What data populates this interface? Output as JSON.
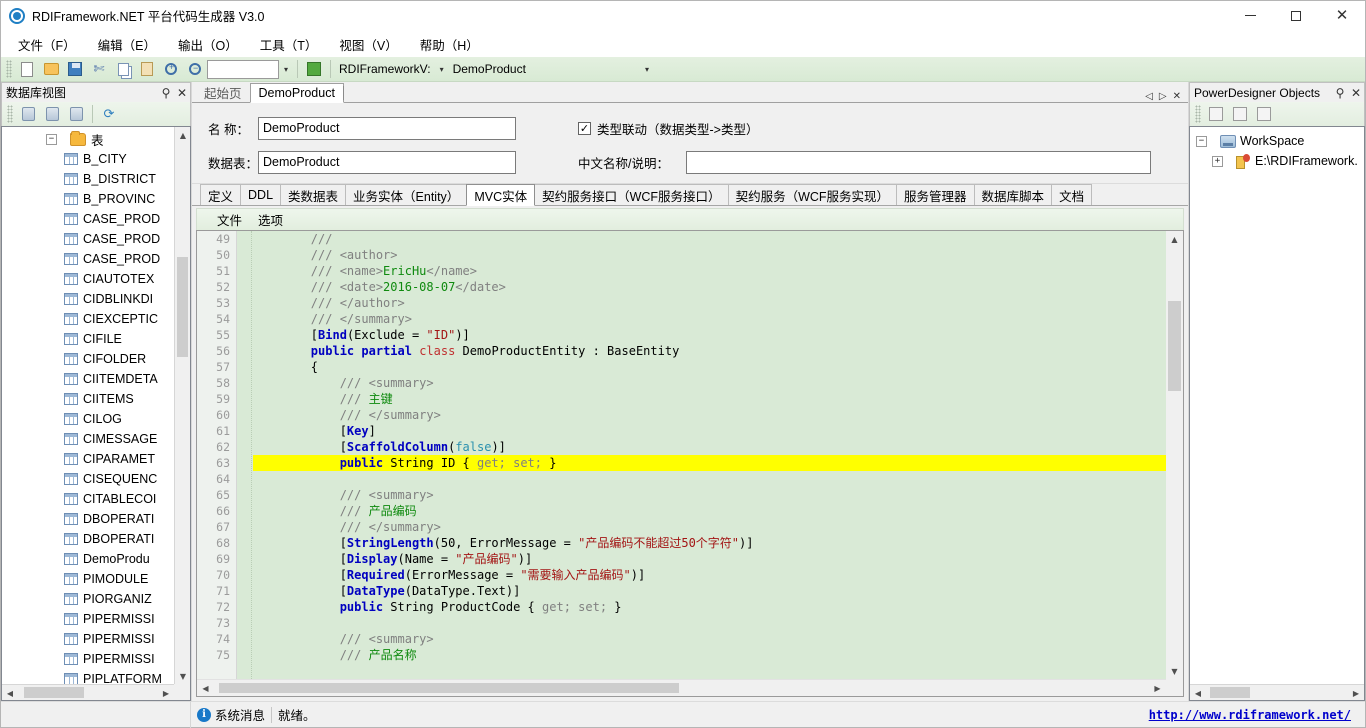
{
  "window": {
    "title": "RDIFramework.NET 平台代码生成器 V3.0",
    "minimize": "—",
    "maximize": "❐",
    "close": "✕"
  },
  "menubar": {
    "items": [
      {
        "label": "文件（F）",
        "name": "menu-file"
      },
      {
        "label": "编辑（E）",
        "name": "menu-edit"
      },
      {
        "label": "输出（O）",
        "name": "menu-output"
      },
      {
        "label": "工具（T）",
        "name": "menu-tools"
      },
      {
        "label": "视图（V）",
        "name": "menu-view"
      },
      {
        "label": "帮助（H）",
        "name": "menu-help"
      }
    ]
  },
  "toolbar": {
    "buttons": [
      {
        "icon": "new-file-icon"
      },
      {
        "icon": "open-folder-icon"
      },
      {
        "icon": "save-icon"
      },
      {
        "icon": "cut-icon"
      },
      {
        "icon": "copy-icon"
      },
      {
        "icon": "paste-icon"
      },
      {
        "icon": "zoom-in-icon"
      },
      {
        "icon": "zoom-out-icon"
      }
    ],
    "search_value": "",
    "search_placeholder": "",
    "dropdown_arrow": "▾",
    "go_icon": "run-icon",
    "connection": "RDIFrameworkV:",
    "table": "DemoProduct"
  },
  "left_dock": {
    "title": "数据库视图",
    "pin_glyph": "⚲",
    "close_glyph": "✕",
    "toolbar_buttons": [
      {
        "icon": "db-add-icon"
      },
      {
        "icon": "db-edit-icon"
      },
      {
        "icon": "db-delete-icon"
      },
      {
        "icon": "refresh-icon"
      }
    ],
    "root": {
      "label": "表",
      "expander": "−"
    },
    "tables": [
      "B_CITY",
      "B_DISTRICT",
      "B_PROVINC",
      "CASE_PROD",
      "CASE_PROD",
      "CASE_PROD",
      "CIAUTOTEX",
      "CIDBLINKDI",
      "CIEXCEPTIC",
      "CIFILE",
      "CIFOLDER",
      "CIITEMDETA",
      "CIITEMS",
      "CILOG",
      "CIMESSAGE",
      "CIPARAMET",
      "CISEQUENC",
      "CITABLECOI",
      "DBOPERATI",
      "DBOPERATI",
      "DemoProdu",
      "PIMODULE",
      "PIORGANIZ",
      "PIPERMISSI",
      "PIPERMISSI",
      "PIPERMISSI",
      "PIPLATFORM"
    ]
  },
  "document_tabs": {
    "tabs": [
      {
        "label": "起始页",
        "active": false
      },
      {
        "label": "DemoProduct",
        "active": true
      }
    ],
    "nav_prev": "◁",
    "nav_next": "▷",
    "nav_close": "✕"
  },
  "form": {
    "name_label": "名 称：",
    "name_value": "DemoProduct",
    "table_label": "数据表：",
    "table_value": "DemoProduct",
    "checkbox_label": "类型联动（数据类型->类型）",
    "checkbox_checked": true,
    "checkbox_glyph": "✓",
    "cn_label": "中文名称/说明：",
    "cn_value": "",
    "cn_placeholder": ""
  },
  "tabstrip": {
    "tabs": [
      {
        "label": "定义",
        "active": false
      },
      {
        "label": "DDL",
        "active": false
      },
      {
        "label": "类数据表",
        "active": false
      },
      {
        "label": "业务实体（Entity）",
        "active": false
      },
      {
        "label": "MVC实体",
        "active": true
      },
      {
        "label": "契约服务接口（WCF服务接口）",
        "active": false
      },
      {
        "label": "契约服务（WCF服务实现）",
        "active": false
      },
      {
        "label": "服务管理器",
        "active": false
      },
      {
        "label": "数据库脚本",
        "active": false
      },
      {
        "label": "文档",
        "active": false
      }
    ]
  },
  "editor": {
    "menu": [
      {
        "label": "文件"
      },
      {
        "label": "选项"
      }
    ],
    "first_line_number": 49,
    "lines": [
      {
        "n": 49,
        "highlight": false,
        "tokens": [
          {
            "t": "        /// ",
            "c": "c-com"
          }
        ]
      },
      {
        "n": 50,
        "highlight": false,
        "tokens": [
          {
            "t": "        /// <author>",
            "c": "c-com"
          }
        ]
      },
      {
        "n": 51,
        "highlight": false,
        "tokens": [
          {
            "t": "        /// <name>",
            "c": "c-com"
          },
          {
            "t": "EricHu",
            "c": "c-comzh"
          },
          {
            "t": "</name>",
            "c": "c-com"
          }
        ]
      },
      {
        "n": 52,
        "highlight": false,
        "tokens": [
          {
            "t": "        /// <date>",
            "c": "c-com"
          },
          {
            "t": "2016-08-07",
            "c": "c-comzh"
          },
          {
            "t": "</date>",
            "c": "c-com"
          }
        ]
      },
      {
        "n": 53,
        "highlight": false,
        "tokens": [
          {
            "t": "        /// </author>",
            "c": "c-com"
          }
        ]
      },
      {
        "n": 54,
        "highlight": false,
        "tokens": [
          {
            "t": "        /// </summary>",
            "c": "c-com"
          }
        ]
      },
      {
        "n": 55,
        "highlight": false,
        "tokens": [
          {
            "t": "        [",
            "c": "c-plain"
          },
          {
            "t": "Bind",
            "c": "c-attr"
          },
          {
            "t": "(Exclude = ",
            "c": "c-plain"
          },
          {
            "t": "\"ID\"",
            "c": "c-str"
          },
          {
            "t": ")]",
            "c": "c-plain"
          }
        ]
      },
      {
        "n": 56,
        "highlight": false,
        "tokens": [
          {
            "t": "        ",
            "c": "c-plain"
          },
          {
            "t": "public",
            "c": "c-kw"
          },
          {
            "t": " ",
            "c": "c-plain"
          },
          {
            "t": "partial",
            "c": "c-kw"
          },
          {
            "t": " ",
            "c": "c-plain"
          },
          {
            "t": "class",
            "c": "c-red"
          },
          {
            "t": " DemoProductEntity : BaseEntity",
            "c": "c-plain"
          }
        ]
      },
      {
        "n": 57,
        "highlight": false,
        "tokens": [
          {
            "t": "        {",
            "c": "c-plain"
          }
        ]
      },
      {
        "n": 58,
        "highlight": false,
        "tokens": [
          {
            "t": "            /// <summary>",
            "c": "c-com"
          }
        ]
      },
      {
        "n": 59,
        "highlight": false,
        "tokens": [
          {
            "t": "            /// ",
            "c": "c-com"
          },
          {
            "t": "主键",
            "c": "c-comzh"
          }
        ]
      },
      {
        "n": 60,
        "highlight": false,
        "tokens": [
          {
            "t": "            /// </summary>",
            "c": "c-com"
          }
        ]
      },
      {
        "n": 61,
        "highlight": false,
        "tokens": [
          {
            "t": "            [",
            "c": "c-plain"
          },
          {
            "t": "Key",
            "c": "c-attr"
          },
          {
            "t": "]",
            "c": "c-plain"
          }
        ]
      },
      {
        "n": 62,
        "highlight": false,
        "tokens": [
          {
            "t": "            [",
            "c": "c-plain"
          },
          {
            "t": "ScaffoldColumn",
            "c": "c-attr"
          },
          {
            "t": "(",
            "c": "c-plain"
          },
          {
            "t": "false",
            "c": "c-type"
          },
          {
            "t": ")]",
            "c": "c-plain"
          }
        ]
      },
      {
        "n": 63,
        "highlight": true,
        "tokens": [
          {
            "t": "            ",
            "c": "c-plain"
          },
          {
            "t": "public",
            "c": "c-kw"
          },
          {
            "t": " String ID { ",
            "c": "c-plain"
          },
          {
            "t": "get; set;",
            "c": "c-getset"
          },
          {
            "t": " }",
            "c": "c-plain"
          }
        ]
      },
      {
        "n": 64,
        "highlight": false,
        "tokens": [
          {
            "t": "",
            "c": "c-plain"
          }
        ]
      },
      {
        "n": 65,
        "highlight": false,
        "tokens": [
          {
            "t": "            /// <summary>",
            "c": "c-com"
          }
        ]
      },
      {
        "n": 66,
        "highlight": false,
        "tokens": [
          {
            "t": "            /// ",
            "c": "c-com"
          },
          {
            "t": "产品编码",
            "c": "c-comzh"
          }
        ]
      },
      {
        "n": 67,
        "highlight": false,
        "tokens": [
          {
            "t": "            /// </summary>",
            "c": "c-com"
          }
        ]
      },
      {
        "n": 68,
        "highlight": false,
        "tokens": [
          {
            "t": "            [",
            "c": "c-plain"
          },
          {
            "t": "StringLength",
            "c": "c-attr"
          },
          {
            "t": "(50, ErrorMessage = ",
            "c": "c-plain"
          },
          {
            "t": "\"产品编码不能超过50个字符\"",
            "c": "c-str"
          },
          {
            "t": ")]",
            "c": "c-plain"
          }
        ]
      },
      {
        "n": 69,
        "highlight": false,
        "tokens": [
          {
            "t": "            [",
            "c": "c-plain"
          },
          {
            "t": "Display",
            "c": "c-attr"
          },
          {
            "t": "(Name = ",
            "c": "c-plain"
          },
          {
            "t": "\"产品编码\"",
            "c": "c-str"
          },
          {
            "t": ")]",
            "c": "c-plain"
          }
        ]
      },
      {
        "n": 70,
        "highlight": false,
        "tokens": [
          {
            "t": "            [",
            "c": "c-plain"
          },
          {
            "t": "Required",
            "c": "c-attr"
          },
          {
            "t": "(ErrorMessage = ",
            "c": "c-plain"
          },
          {
            "t": "\"需要输入产品编码\"",
            "c": "c-str"
          },
          {
            "t": ")]",
            "c": "c-plain"
          }
        ]
      },
      {
        "n": 71,
        "highlight": false,
        "tokens": [
          {
            "t": "            [",
            "c": "c-plain"
          },
          {
            "t": "DataType",
            "c": "c-attr"
          },
          {
            "t": "(DataType.Text)]",
            "c": "c-plain"
          }
        ]
      },
      {
        "n": 72,
        "highlight": false,
        "tokens": [
          {
            "t": "            ",
            "c": "c-plain"
          },
          {
            "t": "public",
            "c": "c-kw"
          },
          {
            "t": " String ProductCode { ",
            "c": "c-plain"
          },
          {
            "t": "get; set;",
            "c": "c-getset"
          },
          {
            "t": " }",
            "c": "c-plain"
          }
        ]
      },
      {
        "n": 73,
        "highlight": false,
        "tokens": [
          {
            "t": "",
            "c": "c-plain"
          }
        ]
      },
      {
        "n": 74,
        "highlight": false,
        "tokens": [
          {
            "t": "            /// <summary>",
            "c": "c-com"
          }
        ]
      },
      {
        "n": 75,
        "highlight": false,
        "tokens": [
          {
            "t": "            /// ",
            "c": "c-com"
          },
          {
            "t": "产品名称",
            "c": "c-comzh"
          }
        ]
      }
    ]
  },
  "right_dock": {
    "title": "PowerDesigner Objects",
    "pin_glyph": "⚲",
    "close_glyph": "✕",
    "toolbar_buttons": [
      {
        "icon": "pd-properties-icon"
      },
      {
        "icon": "pd-check-icon"
      },
      {
        "icon": "pd-delete-icon"
      }
    ],
    "workspace_label": "WorkSpace",
    "workspace_expander": "−",
    "model_label": "E:\\RDIFramework.",
    "model_expander": "+"
  },
  "statusbar": {
    "left_pane": "",
    "message_label": "系统消息",
    "info_glyph": "i",
    "status_text": "就绪。",
    "link": "http://www.rdiframework.net/"
  }
}
